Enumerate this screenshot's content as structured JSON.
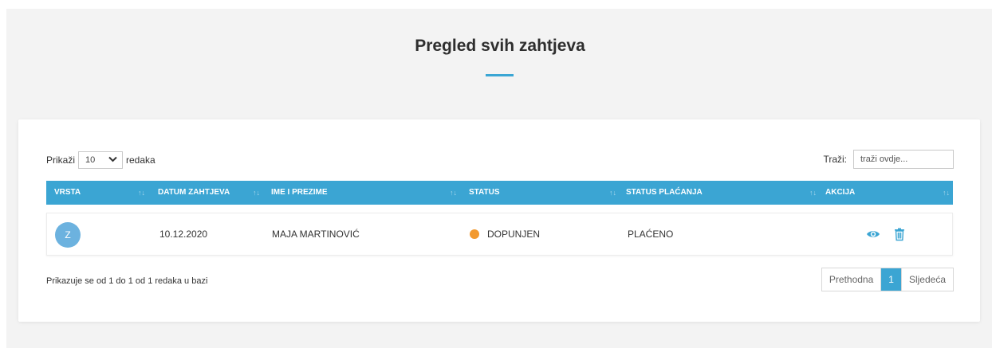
{
  "page": {
    "title": "Pregled svih zahtjeva"
  },
  "length_control": {
    "prefix": "Prikaži",
    "value": "10",
    "suffix": "redaka"
  },
  "search": {
    "label": "Traži:",
    "placeholder": "traži ovdje..."
  },
  "table": {
    "columns": [
      "VRSTA",
      "DATUM ZAHTJEVA",
      "IME I PREZIME",
      "STATUS",
      "STATUS PLAĆANJA",
      "AKCIJA"
    ],
    "sort_glyph": "↑↓",
    "rows": [
      {
        "type_initial": "Z",
        "date": "10.12.2020",
        "name": "MAJA MARTINOVIĆ",
        "status": "DOPUNJEN",
        "payment_status": "PLAĆENO"
      }
    ]
  },
  "footer": {
    "info": "Prikazuje se od 1 do 1 od 1 redaka u bazi",
    "prev_label": "Prethodna",
    "page": "1",
    "next_label": "Sljedeća"
  },
  "colors": {
    "accent": "#3ba5d3",
    "status_dot": "#f2992e",
    "avatar": "#6cb2df"
  },
  "icons": [
    "chevron-down-icon",
    "sort-icon",
    "eye-icon",
    "trash-icon"
  ]
}
